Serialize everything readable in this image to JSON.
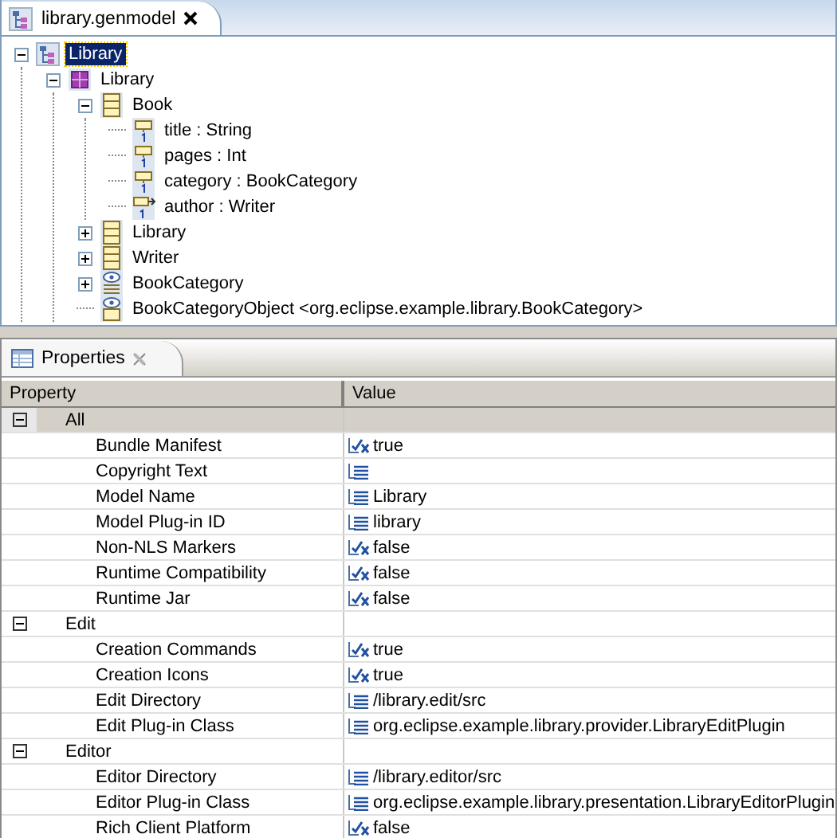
{
  "editor": {
    "tab": {
      "label": "library.genmodel",
      "selected": true
    },
    "tree": [
      {
        "label": "Library",
        "kind": "genmodel",
        "expanded": true,
        "selected": true,
        "children": [
          {
            "label": "Library",
            "kind": "package",
            "expanded": true,
            "selected": false,
            "children": [
              {
                "label": "Book",
                "kind": "class",
                "expanded": true,
                "selected": false,
                "children": [
                  {
                    "label": "title : String",
                    "kind": "attribute",
                    "selected": false
                  },
                  {
                    "label": "pages : Int",
                    "kind": "attribute",
                    "selected": false
                  },
                  {
                    "label": "category : BookCategory",
                    "kind": "attribute",
                    "selected": false
                  },
                  {
                    "label": "author : Writer",
                    "kind": "reference",
                    "selected": false
                  }
                ]
              },
              {
                "label": "Library",
                "kind": "class",
                "expanded": false,
                "selected": false
              },
              {
                "label": "Writer",
                "kind": "class",
                "expanded": false,
                "selected": false
              },
              {
                "label": "BookCategory",
                "kind": "enum",
                "expanded": false,
                "selected": false
              },
              {
                "label": "BookCategoryObject <org.eclipse.example.library.BookCategory>",
                "kind": "datatype",
                "selected": false
              }
            ]
          }
        ]
      }
    ]
  },
  "properties": {
    "tab": {
      "label": "Properties",
      "selected": true
    },
    "columns": [
      "Property",
      "Value"
    ],
    "groups": [
      {
        "label": "All",
        "expanded": true,
        "selected": true,
        "rows": [
          {
            "property": "Bundle Manifest",
            "value": "true",
            "kind": "boolean"
          },
          {
            "property": "Copyright Text",
            "value": "",
            "kind": "text"
          },
          {
            "property": "Model Name",
            "value": "Library",
            "kind": "text"
          },
          {
            "property": "Model Plug-in ID",
            "value": "library",
            "kind": "text"
          },
          {
            "property": "Non-NLS Markers",
            "value": "false",
            "kind": "boolean"
          },
          {
            "property": "Runtime Compatibility",
            "value": "false",
            "kind": "boolean"
          },
          {
            "property": "Runtime Jar",
            "value": "false",
            "kind": "boolean"
          }
        ]
      },
      {
        "label": "Edit",
        "expanded": true,
        "selected": false,
        "rows": [
          {
            "property": "Creation Commands",
            "value": "true",
            "kind": "boolean"
          },
          {
            "property": "Creation Icons",
            "value": "true",
            "kind": "boolean"
          },
          {
            "property": "Edit Directory",
            "value": "/library.edit/src",
            "kind": "text"
          },
          {
            "property": "Edit Plug-in Class",
            "value": "org.eclipse.example.library.provider.LibraryEditPlugin",
            "kind": "text"
          }
        ]
      },
      {
        "label": "Editor",
        "expanded": true,
        "selected": false,
        "rows": [
          {
            "property": "Editor Directory",
            "value": "/library.editor/src",
            "kind": "text"
          },
          {
            "property": "Editor Plug-in Class",
            "value": "org.eclipse.example.library.presentation.LibraryEditorPlugin",
            "kind": "text"
          },
          {
            "property": "Rich Client Platform",
            "value": "false",
            "kind": "boolean"
          }
        ]
      }
    ]
  }
}
